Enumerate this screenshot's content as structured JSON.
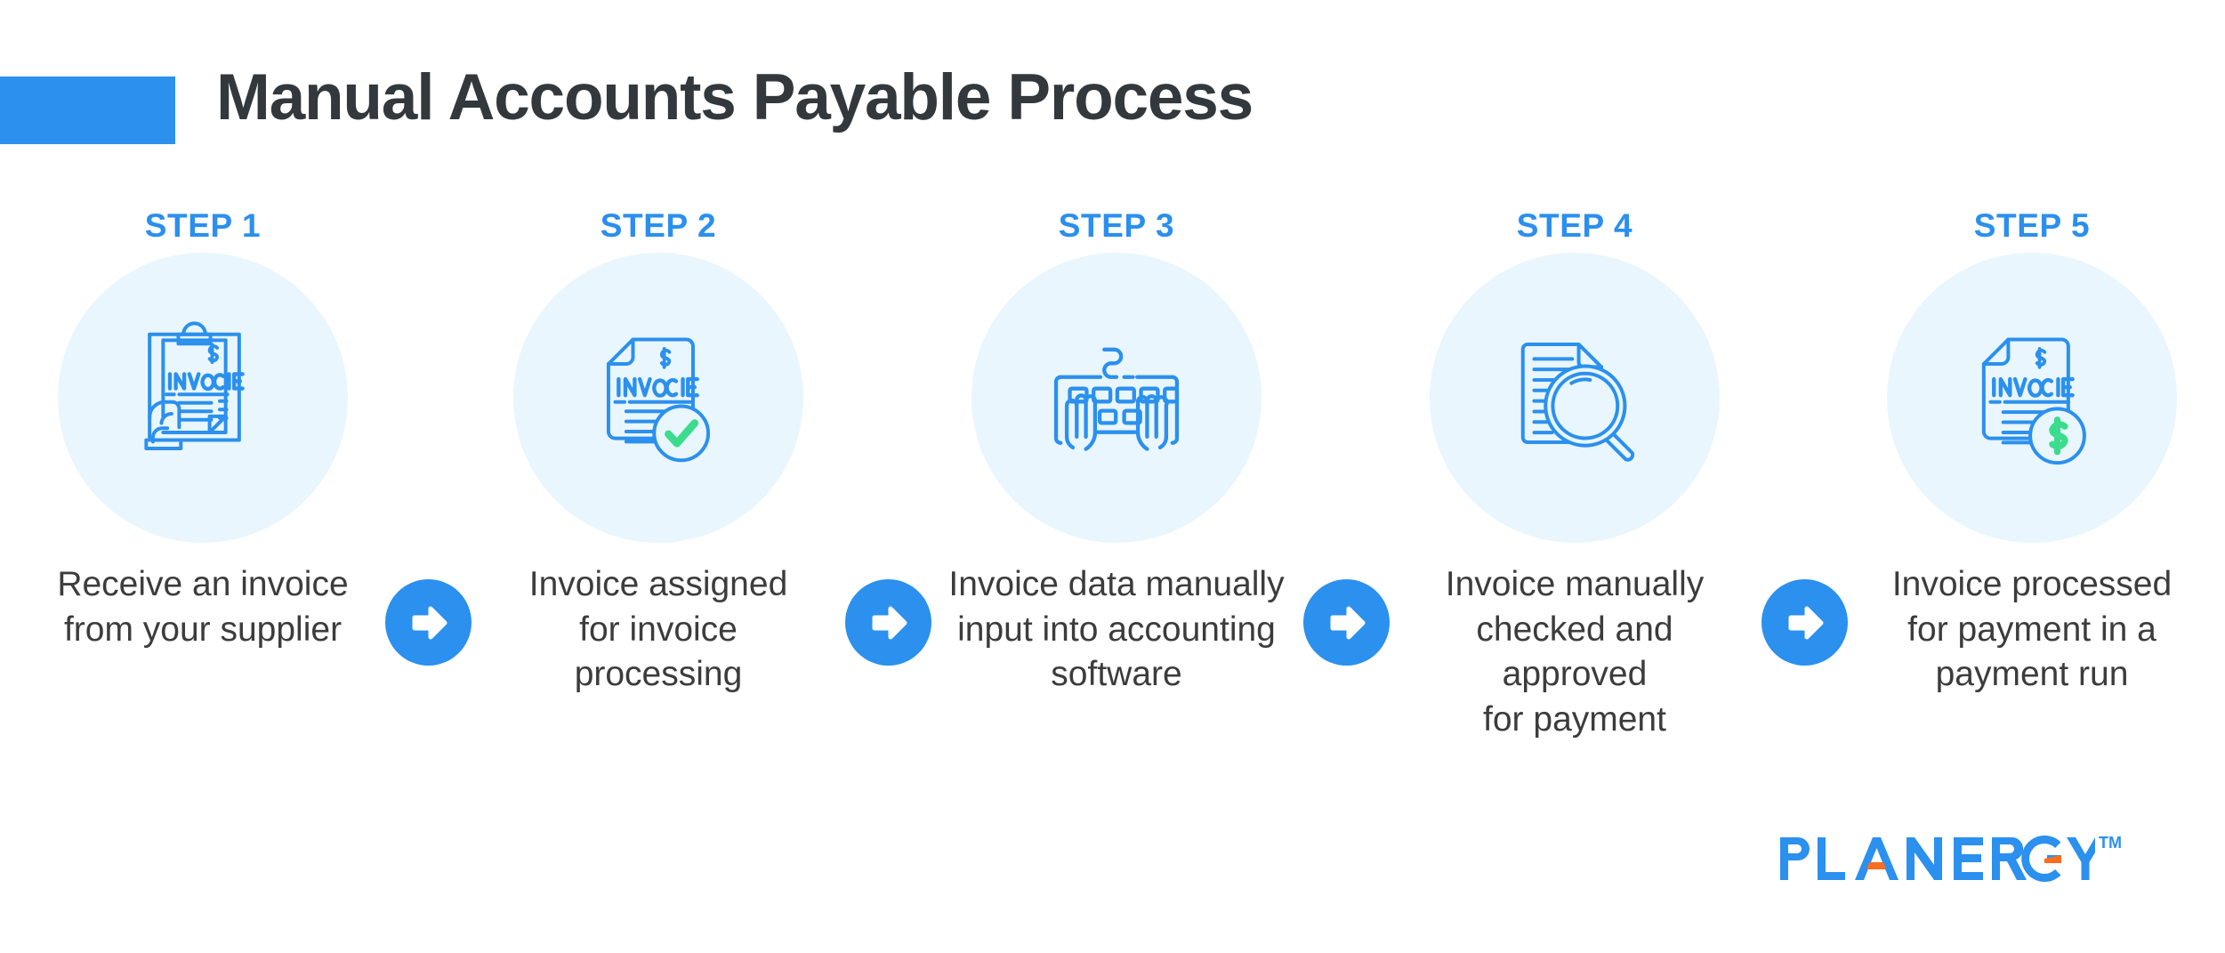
{
  "header": {
    "title": "Manual Accounts Payable Process",
    "accent_color": "#2B90EE",
    "title_color": "#33383D"
  },
  "theme": {
    "brand_blue": "#2B90EE",
    "icon_blue": "#2B90EE",
    "circle_bg": "#E9F6FD",
    "green": "#3BDC8C",
    "orange": "#F96D20",
    "text_dark": "#3C3C3C",
    "background": "#FFFFFF"
  },
  "steps": [
    {
      "label": "STEP 1",
      "icon": "invoice-clipboard-in-hand-icon",
      "icon_texts": [
        "$",
        "INVOICE"
      ],
      "caption": "Receive an invoice\nfrom your supplier"
    },
    {
      "label": "STEP 2",
      "icon": "invoice-approved-check-icon",
      "icon_texts": [
        "$",
        "INVOICE"
      ],
      "caption": "Invoice assigned\nfor invoice\nprocessing"
    },
    {
      "label": "STEP 3",
      "icon": "keyboard-typing-hands-icon",
      "icon_texts": [],
      "caption": "Invoice data manually\ninput into accounting\nsoftware"
    },
    {
      "label": "STEP 4",
      "icon": "document-magnifier-review-icon",
      "icon_texts": [],
      "caption": "Invoice manually\nchecked and\napproved\nfor payment"
    },
    {
      "label": "STEP 5",
      "icon": "invoice-dollar-coin-icon",
      "icon_texts": [
        "$",
        "INVOICE"
      ],
      "caption": "Invoice processed\nfor payment in a\npayment run"
    }
  ],
  "arrows": [
    {
      "icon": "arrow-right-icon"
    },
    {
      "icon": "arrow-right-icon"
    },
    {
      "icon": "arrow-right-icon"
    },
    {
      "icon": "arrow-right-icon"
    }
  ],
  "logo": {
    "wordmark": "PLANERGY",
    "trademark": "TM",
    "color": "#2B90EE",
    "accent_color": "#F96D20"
  }
}
